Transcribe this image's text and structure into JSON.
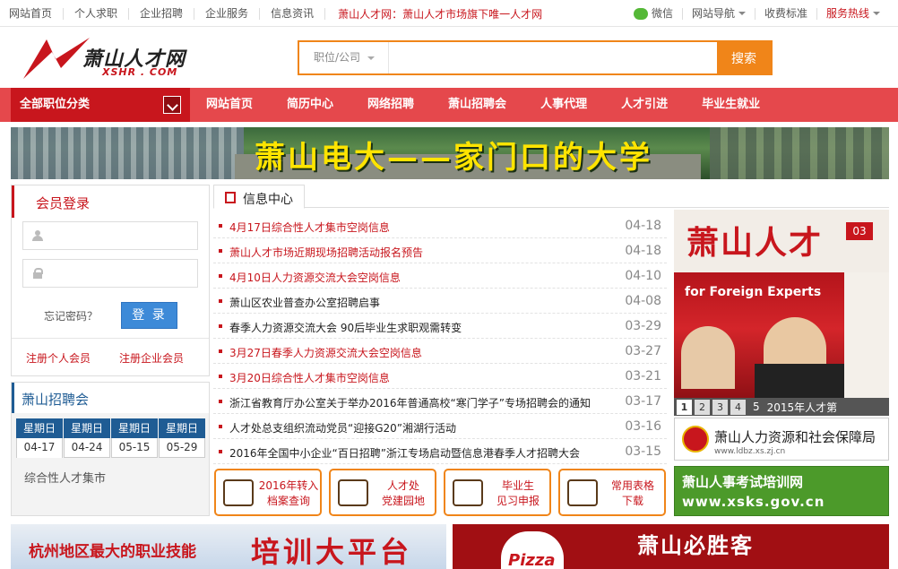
{
  "topbar": {
    "links": [
      "网站首页",
      "个人求职",
      "企业招聘",
      "企业服务",
      "信息资讯"
    ],
    "slogan": "萧山人才网：萧山人才市场旗下唯一人才网",
    "right": {
      "wechat": "微信",
      "site_nav": "网站导航",
      "fees": "收费标准",
      "hotline": "服务热线"
    }
  },
  "logo": {
    "name": "萧山人才网",
    "domain": "XSHR . COM"
  },
  "search": {
    "select_value": "职位/公司",
    "placeholder": "",
    "button": "搜索"
  },
  "nav": {
    "category": "全部职位分类",
    "items": [
      "网站首页",
      "简历中心",
      "网络招聘",
      "萧山招聘会",
      "人事代理",
      "人才引进",
      "毕业生就业"
    ]
  },
  "banner": {
    "text": "萧山电大——家门口的大学"
  },
  "login": {
    "title": "会员登录",
    "user_placeholder": "",
    "pass_placeholder": "",
    "forgot": "忘记密码？",
    "button": "登 录",
    "register_person": "注册个人会员",
    "register_company": "注册企业会员"
  },
  "fair": {
    "title": "萧山招聘会",
    "tabs": [
      {
        "weekday": "星期日",
        "date": "04-17"
      },
      {
        "weekday": "星期日",
        "date": "04-24"
      },
      {
        "weekday": "星期日",
        "date": "05-15"
      },
      {
        "weekday": "星期日",
        "date": "05-29"
      }
    ],
    "desc": "综合性人才集市"
  },
  "info": {
    "title": "信息中心",
    "items": [
      {
        "title": "4月17日综合性人才集市空岗信息",
        "date": "04-18",
        "red": true
      },
      {
        "title": "萧山人才市场近期现场招聘活动报名预告",
        "date": "04-18",
        "red": true
      },
      {
        "title": "4月10日人力资源交流大会空岗信息",
        "date": "04-10",
        "red": true
      },
      {
        "title": "萧山区农业普查办公室招聘启事",
        "date": "04-08",
        "red": false
      },
      {
        "title": "春季人力资源交流大会 90后毕业生求职观需转变",
        "date": "03-29",
        "red": false
      },
      {
        "title": "3月27日春季人力资源交流大会空岗信息",
        "date": "03-27",
        "red": true
      },
      {
        "title": "3月20日综合性人才集市空岗信息",
        "date": "03-21",
        "red": true
      },
      {
        "title": "浙江省教育厅办公室关于举办2016年普通高校“寒门学子”专场招聘会的通知",
        "date": "03-17",
        "red": false
      },
      {
        "title": "人才处总支组织流动党员“迎接G20”湘湖行活动",
        "date": "03-16",
        "red": false
      },
      {
        "title": "2016年全国中小企业“百日招聘”浙江专场启动暨信息港春季人才招聘大会",
        "date": "03-15",
        "red": false
      }
    ]
  },
  "quick": [
    {
      "l1": "2016年转入",
      "l2": "档案查询",
      "icon": "search-document-icon"
    },
    {
      "l1": "人才处",
      "l2": "党建园地",
      "icon": "people-icon"
    },
    {
      "l1": "毕业生",
      "l2": "见习申报",
      "icon": "edit-icon"
    },
    {
      "l1": "常用表格",
      "l2": "下载",
      "icon": "mouse-icon"
    }
  ],
  "magazine": {
    "title": "萧山人才",
    "issue": "03",
    "cover_text": "for Foreign Experts",
    "pages": [
      "1",
      "2",
      "3",
      "4",
      "5"
    ],
    "caption": "2015年人才第"
  },
  "ads": {
    "hrss": "萧山人力资源和社会保障局",
    "hrss_url": "www.ldbz.xs.zj.cn",
    "exam": "萧山人事考试培训网",
    "exam_url": "www.xsks.gov.cn"
  },
  "bottom": {
    "left_small": "杭州地区最大的职业技能",
    "left_big": "培训大平台",
    "right_logo": "Pizza",
    "right_text": "萧山必胜客"
  },
  "colors": {
    "brand_red": "#c8161d",
    "nav_red": "#e5484c",
    "orange": "#f08519",
    "blue": "#1f5c94"
  }
}
